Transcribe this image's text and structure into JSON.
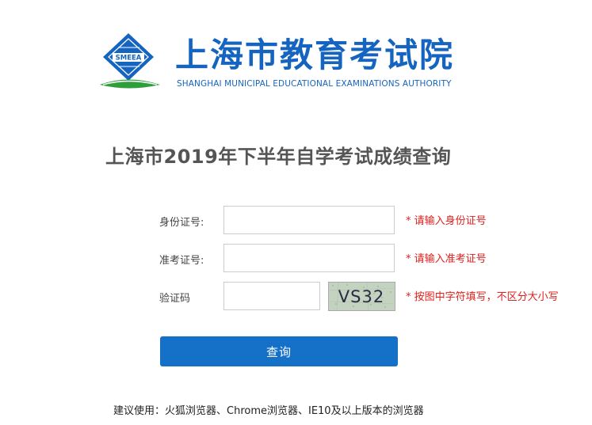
{
  "header": {
    "logo_text": "SMEEA",
    "org_name": "上海市教育考试院",
    "org_name_en": "SHANGHAI MUNICIPAL EDUCATIONAL EXAMINATIONS AUTHORITY",
    "colors": {
      "brand_blue": "#1565c0",
      "brand_green": "#2e9e3a"
    }
  },
  "page": {
    "title": "上海市2019年下半年自学考试成绩查询"
  },
  "form": {
    "id_number": {
      "label": "身份证号:",
      "value": "",
      "placeholder": "",
      "hint": "* 请输入身份证号"
    },
    "admission_number": {
      "label": "准考证号:",
      "value": "",
      "placeholder": "",
      "hint": "* 请输入准考证号"
    },
    "captcha": {
      "label": "验证码",
      "value": "",
      "placeholder": "",
      "image_text": "VS32",
      "hint": "* 按图中字符填写，不区分大小写"
    },
    "submit_label": "查询",
    "hint_color": "#e0201e",
    "button_color": "#1570c8"
  },
  "footer": {
    "browser_note": "建议使用：火狐浏览器、Chrome浏览器、IE10及以上版本的浏览器"
  }
}
